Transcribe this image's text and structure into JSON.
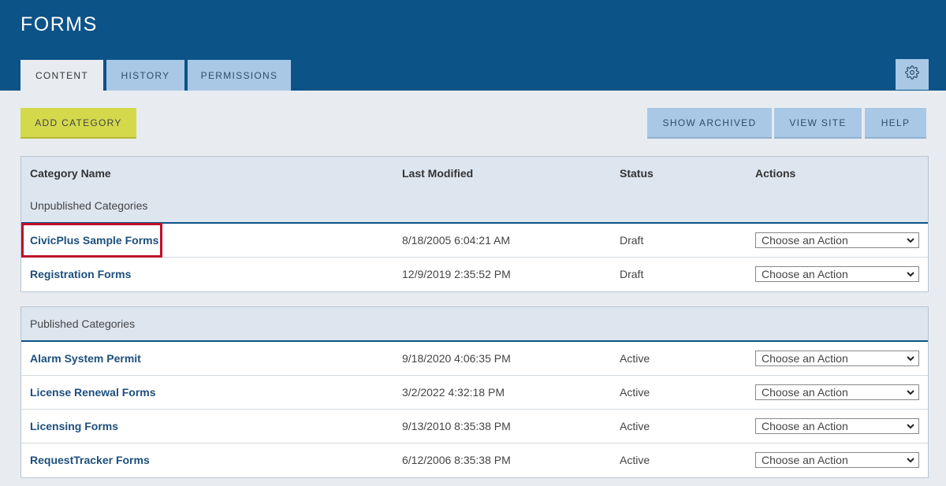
{
  "header": {
    "title": "FORMS",
    "tabs": [
      "CONTENT",
      "HISTORY",
      "PERMISSIONS"
    ]
  },
  "toolbar": {
    "add_category": "ADD CATEGORY",
    "show_archived": "SHOW ARCHIVED",
    "view_site": "VIEW SITE",
    "help": "HELP"
  },
  "table": {
    "columns": [
      "Category Name",
      "Last Modified",
      "Status",
      "Actions"
    ],
    "unpublished_label": "Unpublished Categories",
    "published_label": "Published Categories",
    "action_placeholder": "Choose an Action",
    "unpublished": [
      {
        "name": "CivicPlus Sample Forms",
        "modified": "8/18/2005 6:04:21 AM",
        "status": "Draft"
      },
      {
        "name": "Registration Forms",
        "modified": "12/9/2019 2:35:52 PM",
        "status": "Draft"
      }
    ],
    "published": [
      {
        "name": "Alarm System Permit",
        "modified": "9/18/2020 4:06:35 PM",
        "status": "Active"
      },
      {
        "name": "License Renewal Forms",
        "modified": "3/2/2022 4:32:18 PM",
        "status": "Active"
      },
      {
        "name": "Licensing Forms",
        "modified": "9/13/2010 8:35:38 PM",
        "status": "Active"
      },
      {
        "name": "RequestTracker Forms",
        "modified": "6/12/2006 8:35:38 PM",
        "status": "Active"
      }
    ]
  },
  "icons": {
    "settings": "gear-icon",
    "dropdown": "chevron-down-icon"
  },
  "colors": {
    "header_bg": "#0c5387",
    "tab_inactive": "#a8c8e6",
    "add_button": "#d4d94c",
    "link": "#1d4f7c",
    "highlight": "#c0102a"
  }
}
